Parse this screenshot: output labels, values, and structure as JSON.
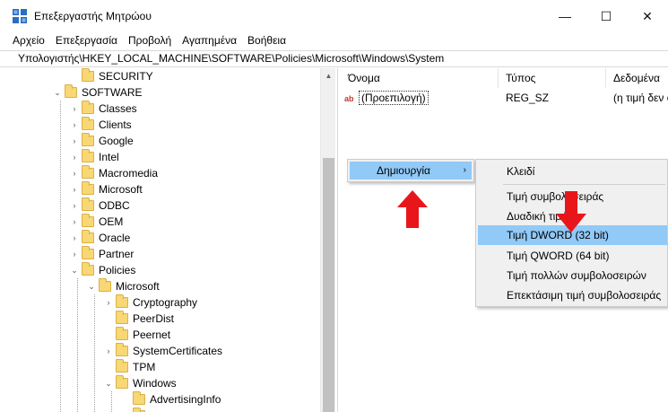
{
  "window": {
    "title": "Επεξεργαστής Μητρώου",
    "minimize_glyph": "—",
    "maximize_glyph": "☐",
    "close_glyph": "✕"
  },
  "menubar": {
    "items": [
      "Αρχείο",
      "Επεξεργασία",
      "Προβολή",
      "Αγαπημένα",
      "Βοήθεια"
    ]
  },
  "address": {
    "path": "Υπολογιστής\\HKEY_LOCAL_MACHINE\\SOFTWARE\\Policies\\Microsoft\\Windows\\System"
  },
  "tree": {
    "items": [
      {
        "label": "SECURITY",
        "arrow": ""
      },
      {
        "label": "SOFTWARE",
        "arrow": "⌄"
      },
      {
        "label": "Classes",
        "arrow": "›"
      },
      {
        "label": "Clients",
        "arrow": "›"
      },
      {
        "label": "Google",
        "arrow": "›"
      },
      {
        "label": "Intel",
        "arrow": "›"
      },
      {
        "label": "Macromedia",
        "arrow": "›"
      },
      {
        "label": "Microsoft",
        "arrow": "›"
      },
      {
        "label": "ODBC",
        "arrow": "›"
      },
      {
        "label": "OEM",
        "arrow": "›"
      },
      {
        "label": "Oracle",
        "arrow": "›"
      },
      {
        "label": "Partner",
        "arrow": "›"
      },
      {
        "label": "Policies",
        "arrow": "⌄"
      },
      {
        "label": "Microsoft",
        "arrow": "⌄"
      },
      {
        "label": "Cryptography",
        "arrow": "›"
      },
      {
        "label": "PeerDist",
        "arrow": ""
      },
      {
        "label": "Peernet",
        "arrow": ""
      },
      {
        "label": "SystemCertificates",
        "arrow": "›"
      },
      {
        "label": "TPM",
        "arrow": ""
      },
      {
        "label": "Windows",
        "arrow": "⌄"
      },
      {
        "label": "AdvertisingInfo",
        "arrow": ""
      },
      {
        "label": "",
        "arrow": ""
      }
    ]
  },
  "list": {
    "columns": [
      "Όνομα",
      "Τύπος",
      "Δεδομένα"
    ],
    "rows": [
      {
        "icon": "ab",
        "name": "(Προεπιλογή)",
        "type": "REG_SZ",
        "data": "(η τιμή δεν ο"
      }
    ]
  },
  "context_menu": {
    "label": "Δημιουργία",
    "arrow": "›"
  },
  "submenu": {
    "items": [
      {
        "label": "Κλειδί"
      },
      {
        "label": "Τιμή συμβολοσειράς"
      },
      {
        "label": "Δυαδική τιμή"
      },
      {
        "label": "Τιμή DWORD (32 bit)"
      },
      {
        "label": "Τιμή QWORD (64 bit)"
      },
      {
        "label": "Τιμή πολλών συμβολοσειρών"
      },
      {
        "label": "Επεκτάσιμη τιμή συμβολοσειράς"
      }
    ]
  },
  "colors": {
    "highlight": "#91c9f7",
    "arrow_red": "#e8161b",
    "folder": "#f8d775"
  },
  "scrollbar": {
    "up_glyph": "▲"
  }
}
